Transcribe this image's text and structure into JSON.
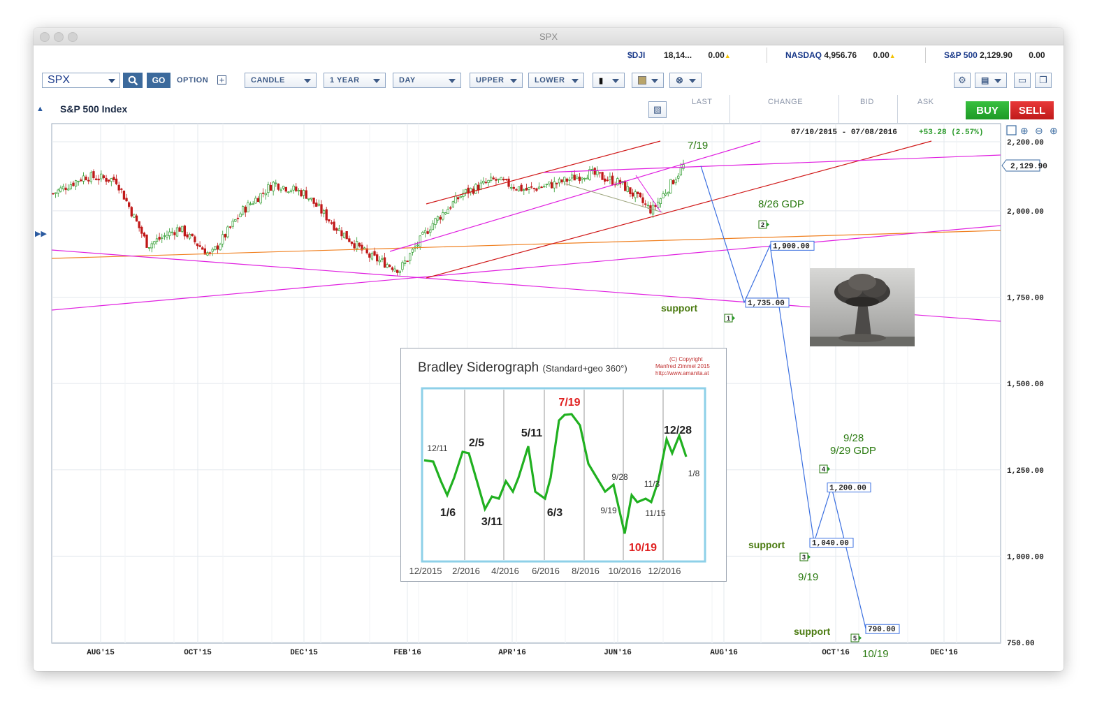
{
  "window": {
    "title": "SPX"
  },
  "tickers": [
    {
      "symbol": "$DJI",
      "value": "18,14...",
      "change": "0.00"
    },
    {
      "symbol": "NASDAQ",
      "value": "4,956.76",
      "change": "0.00"
    },
    {
      "symbol": "S&P 500",
      "value": "2,129.90",
      "change": "0.00"
    }
  ],
  "toolbar": {
    "symbol_value": "SPX",
    "go_label": "GO",
    "option_label": "OPTION",
    "chart_type": "CANDLE",
    "period": "1 YEAR",
    "interval": "DAY",
    "upper": "UPPER",
    "lower": "LOWER"
  },
  "header": {
    "title": "S&P 500 Index",
    "columns": [
      "LAST",
      "CHANGE",
      "BID",
      "ASK"
    ],
    "buy_label": "BUY",
    "sell_label": "SELL"
  },
  "chart": {
    "date_range": "07/10/2015 - 07/08/2016",
    "change_text": "+53.28 (2.57%)",
    "last_price_tag": "2,129.90",
    "y_ticks": [
      "2,200.00",
      "2,000.00",
      "1,750.00",
      "1,500.00",
      "1,250.00",
      "1,000.00",
      "750.00"
    ],
    "x_ticks": [
      "AUG'15",
      "OCT'15",
      "DEC'15",
      "FEB'16",
      "APR'16",
      "JUN'16",
      "AUG'16",
      "OCT'16",
      "DEC'16"
    ],
    "colors": {
      "up": "#2a9a2a",
      "down": "#c01818",
      "projection": "#3a6fe0",
      "channel_red": "#d01818",
      "channel_magenta": "#e020e0",
      "orange": "#f08020",
      "annotation": "#2a7a10"
    }
  },
  "annotations": {
    "jul19": "7/19",
    "gdp_826": "8/26 GDP",
    "support_1": "support",
    "label_928": "9/28",
    "gdp_929": "9/29 GDP",
    "support_3": "support",
    "label_919": "9/19",
    "support_5": "support",
    "label_1019": "10/19",
    "points": [
      {
        "num": "1",
        "price": "1,735.00"
      },
      {
        "num": "2",
        "price": "1,900.00"
      },
      {
        "num": "3",
        "price": "1,040.00"
      },
      {
        "num": "4",
        "price": "1,200.00"
      },
      {
        "num": "5",
        "price": "790.00"
      }
    ]
  },
  "inset": {
    "title": "Bradley Siderograph",
    "subtitle": "(Standard+geo 360°)",
    "copyright": [
      "(C) Copyright",
      "Manfred Zimmel 2015",
      "http://www.amanita.at"
    ],
    "x_labels": [
      "12/2015",
      "2/2016",
      "4/2016",
      "6/2016",
      "8/2016",
      "10/2016",
      "12/2016"
    ],
    "peak_labels": [
      "12/11",
      "1/6",
      "2/5",
      "3/11",
      "5/11",
      "6/3",
      "7/19",
      "9/19",
      "9/28",
      "10/19",
      "11/3",
      "11/15",
      "12/28",
      "1/8"
    ]
  },
  "chart_data": {
    "type": "line",
    "title": "S&P 500 Index",
    "xlabel": "",
    "ylabel": "",
    "ylim": [
      750,
      2200
    ],
    "series": [
      {
        "values": [
          2050,
          2100,
          2090,
          1900,
          1950,
          1870,
          2000,
          2080,
          2050,
          1950,
          1870,
          1830,
          1960,
          2050,
          2090,
          2060,
          2080,
          2110,
          2080,
          2000,
          2130
        ]
      },
      {
        "name": "",
        "x": [
          "07/19/2016",
          "08/26/2016",
          "09/02/2016",
          "09/19/2016",
          "09/28/2016",
          "10/19/2016"
        ],
        "values": [
          2130,
          1735,
          1900,
          1040,
          1200,
          790
        ]
      }
    ],
    "projection_points": [
      {
        "label": "1",
        "value": 1735
      },
      {
        "label": "2",
        "value": 1900
      },
      {
        "label": "3",
        "value": 1040
      },
      {
        "label": "4",
        "value": 1200
      },
      {
        "label": "5",
        "value": 790
      }
    ],
    "grid": true
  }
}
